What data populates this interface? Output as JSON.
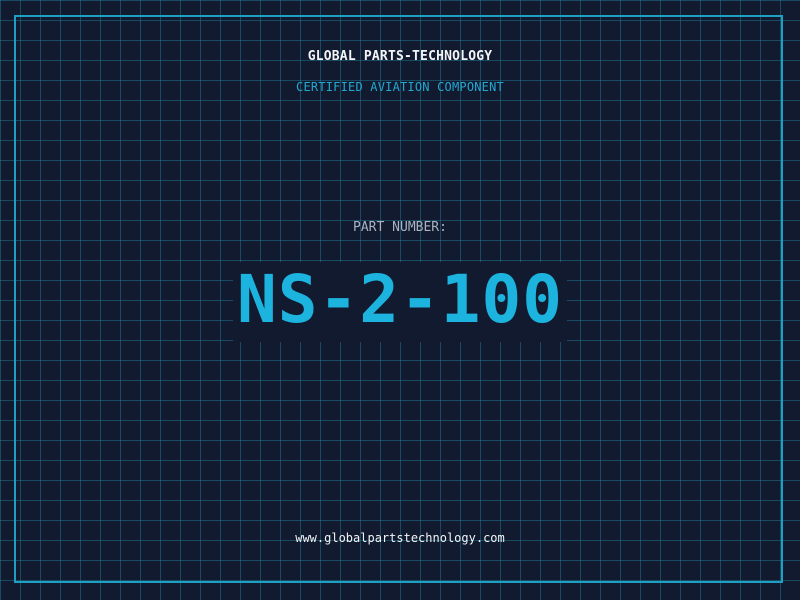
{
  "header": {
    "company": "GLOBAL PARTS-TECHNOLOGY",
    "subtitle": "CERTIFIED AVIATION COMPONENT"
  },
  "part": {
    "label": "PART NUMBER:",
    "number": "NS-2-100"
  },
  "footer": {
    "url": "www.globalpartstechnology.com"
  },
  "colors": {
    "background": "#111a2e",
    "grid": "#2896b4",
    "frame": "#1f9fc4",
    "accent": "#1db3df",
    "label": "#a9b3c3",
    "text": "#f2f4f7"
  }
}
